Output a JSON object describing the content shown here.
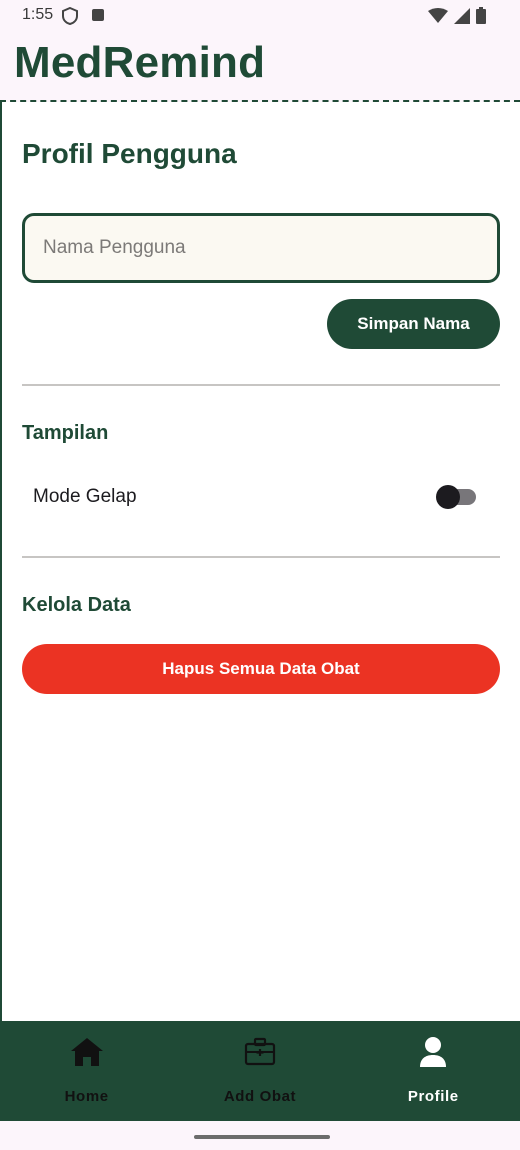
{
  "status_bar": {
    "time": "1:55",
    "icons": [
      "shield-icon",
      "notification-a-icon",
      "wifi-icon",
      "signal-icon",
      "battery-icon"
    ]
  },
  "app_bar": {
    "title": "MedRemind"
  },
  "profile": {
    "title": "Profil Pengguna",
    "name_input": {
      "placeholder": "Nama Pengguna",
      "value": ""
    },
    "save_button_label": "Simpan Nama"
  },
  "appearance": {
    "heading": "Tampilan",
    "dark_mode_label": "Mode Gelap",
    "dark_mode_on": false
  },
  "data_management": {
    "heading": "Kelola Data",
    "delete_all_label": "Hapus Semua Data Obat"
  },
  "bottom_nav": {
    "items": [
      {
        "label": "Home",
        "icon": "home-icon",
        "active": false
      },
      {
        "label": "Add Obat",
        "icon": "medical-kit-icon",
        "active": false
      },
      {
        "label": "Profile",
        "icon": "person-icon",
        "active": true
      }
    ]
  },
  "colors": {
    "primary": "#1f4a36",
    "danger": "#eb3323",
    "surface": "#fcf5fb",
    "input_background": "#fbf9f2"
  }
}
